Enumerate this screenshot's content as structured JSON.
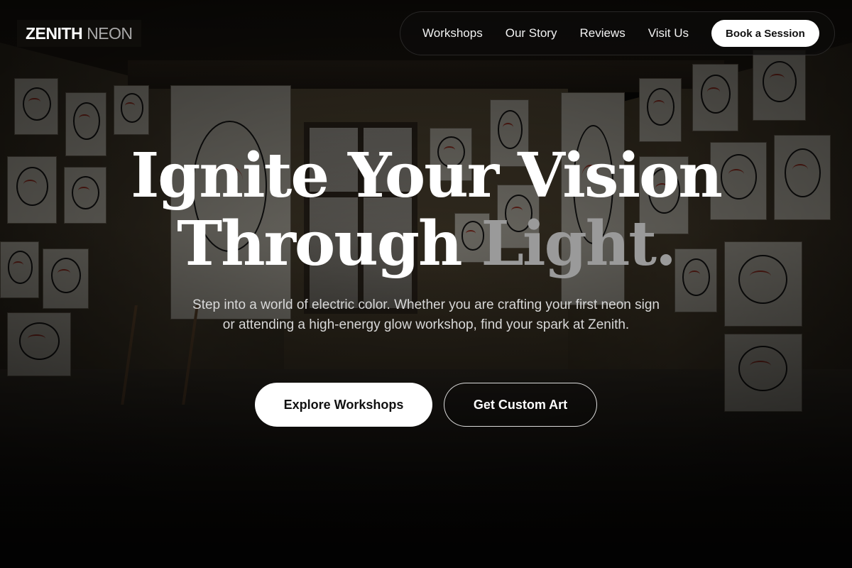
{
  "brand": {
    "name_primary": "ZENITH",
    "name_secondary": "NEON"
  },
  "nav": {
    "links": [
      "Workshops",
      "Our Story",
      "Reviews",
      "Visit Us"
    ],
    "cta_label": "Book a Session"
  },
  "hero": {
    "title_line1": "Ignite Your Vision",
    "title_line2_main": "Through",
    "title_line2_accent": "Light.",
    "subtitle": "Step into a world of electric color. Whether you are crafting your first neon sign or attending a high-energy glow workshop, find your spark at Zenith.",
    "primary_button": "Explore Workshops",
    "secondary_button": "Get Custom Art",
    "background_image": "art-studio-photo"
  },
  "colors": {
    "accent_text": "#9a9a9a",
    "button_bg": "#ffffff",
    "nav_bg": "#0c0b0a"
  }
}
